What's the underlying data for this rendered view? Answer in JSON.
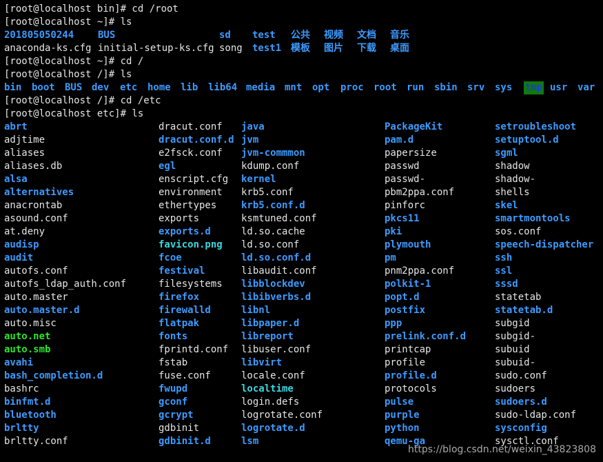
{
  "terminal": {
    "prompts": [
      "[root@localhost bin]# cd /root",
      "[root@localhost ~]# ls",
      "[root@localhost ~]# cd /",
      "[root@localhost /]# ls",
      "[root@localhost /]# cd /etc",
      "[root@localhost etc]# ls"
    ],
    "root_listing": [
      [
        {
          "text": "201805050244",
          "type": "dir"
        },
        {
          "text": "BUS",
          "type": "dir"
        },
        {
          "text": "sd",
          "type": "dir"
        },
        {
          "text": "test",
          "type": "dir"
        },
        {
          "text": "公共",
          "type": "dir"
        },
        {
          "text": "视频",
          "type": "dir"
        },
        {
          "text": "文档",
          "type": "dir"
        },
        {
          "text": "音乐",
          "type": "dir"
        }
      ],
      [
        {
          "text": "anaconda-ks.cfg",
          "type": "file"
        },
        {
          "text": "initial-setup-ks.cfg",
          "type": "file"
        },
        {
          "text": "song",
          "type": "file"
        },
        {
          "text": "test1",
          "type": "dir"
        },
        {
          "text": "模板",
          "type": "dir"
        },
        {
          "text": "图片",
          "type": "dir"
        },
        {
          "text": "下载",
          "type": "dir"
        },
        {
          "text": "桌面",
          "type": "dir"
        }
      ]
    ],
    "slash_listing": [
      {
        "text": "bin",
        "type": "dir"
      },
      {
        "text": "boot",
        "type": "dir"
      },
      {
        "text": "BUS",
        "type": "dir"
      },
      {
        "text": "dev",
        "type": "dir"
      },
      {
        "text": "etc",
        "type": "dir"
      },
      {
        "text": "home",
        "type": "dir"
      },
      {
        "text": "lib",
        "type": "dir"
      },
      {
        "text": "lib64",
        "type": "dir"
      },
      {
        "text": "media",
        "type": "dir"
      },
      {
        "text": "mnt",
        "type": "dir"
      },
      {
        "text": "opt",
        "type": "dir"
      },
      {
        "text": "proc",
        "type": "dir"
      },
      {
        "text": "root",
        "type": "dir"
      },
      {
        "text": "run",
        "type": "dir"
      },
      {
        "text": "sbin",
        "type": "dir"
      },
      {
        "text": "srv",
        "type": "dir"
      },
      {
        "text": "sys",
        "type": "dir"
      },
      {
        "text": "tmp",
        "type": "tmp"
      },
      {
        "text": "usr",
        "type": "dir"
      },
      {
        "text": "var",
        "type": "dir"
      }
    ],
    "etc_columns": [
      [
        {
          "text": "abrt",
          "type": "dir"
        },
        {
          "text": "adjtime",
          "type": "file"
        },
        {
          "text": "aliases",
          "type": "file"
        },
        {
          "text": "aliases.db",
          "type": "file"
        },
        {
          "text": "alsa",
          "type": "dir"
        },
        {
          "text": "alternatives",
          "type": "dir"
        },
        {
          "text": "anacrontab",
          "type": "file"
        },
        {
          "text": "asound.conf",
          "type": "file"
        },
        {
          "text": "at.deny",
          "type": "file"
        },
        {
          "text": "audisp",
          "type": "dir"
        },
        {
          "text": "audit",
          "type": "dir"
        },
        {
          "text": "autofs.conf",
          "type": "file"
        },
        {
          "text": "autofs_ldap_auth.conf",
          "type": "file"
        },
        {
          "text": "auto.master",
          "type": "file"
        },
        {
          "text": "auto.master.d",
          "type": "dir"
        },
        {
          "text": "auto.misc",
          "type": "file"
        },
        {
          "text": "auto.net",
          "type": "exec"
        },
        {
          "text": "auto.smb",
          "type": "exec"
        },
        {
          "text": "avahi",
          "type": "dir"
        },
        {
          "text": "bash_completion.d",
          "type": "dir"
        },
        {
          "text": "bashrc",
          "type": "file"
        },
        {
          "text": "binfmt.d",
          "type": "dir"
        },
        {
          "text": "bluetooth",
          "type": "dir"
        },
        {
          "text": "brltty",
          "type": "dir"
        },
        {
          "text": "brltty.conf",
          "type": "file"
        }
      ],
      [
        {
          "text": "dracut.conf",
          "type": "file"
        },
        {
          "text": "dracut.conf.d",
          "type": "dir"
        },
        {
          "text": "e2fsck.conf",
          "type": "file"
        },
        {
          "text": "egl",
          "type": "dir"
        },
        {
          "text": "enscript.cfg",
          "type": "file"
        },
        {
          "text": "environment",
          "type": "file"
        },
        {
          "text": "ethertypes",
          "type": "file"
        },
        {
          "text": "exports",
          "type": "file"
        },
        {
          "text": "exports.d",
          "type": "dir"
        },
        {
          "text": "favicon.png",
          "type": "link"
        },
        {
          "text": "fcoe",
          "type": "dir"
        },
        {
          "text": "festival",
          "type": "dir"
        },
        {
          "text": "filesystems",
          "type": "file"
        },
        {
          "text": "firefox",
          "type": "dir"
        },
        {
          "text": "firewalld",
          "type": "dir"
        },
        {
          "text": "flatpak",
          "type": "dir"
        },
        {
          "text": "fonts",
          "type": "dir"
        },
        {
          "text": "fprintd.conf",
          "type": "file"
        },
        {
          "text": "fstab",
          "type": "file"
        },
        {
          "text": "fuse.conf",
          "type": "file"
        },
        {
          "text": "fwupd",
          "type": "dir"
        },
        {
          "text": "gconf",
          "type": "dir"
        },
        {
          "text": "gcrypt",
          "type": "dir"
        },
        {
          "text": "gdbinit",
          "type": "file"
        },
        {
          "text": "gdbinit.d",
          "type": "dir"
        }
      ],
      [
        {
          "text": "java",
          "type": "dir"
        },
        {
          "text": "jvm",
          "type": "dir"
        },
        {
          "text": "jvm-commmon",
          "type": "dir"
        },
        {
          "text": "kdump.conf",
          "type": "file"
        },
        {
          "text": "kernel",
          "type": "dir"
        },
        {
          "text": "krb5.conf",
          "type": "file"
        },
        {
          "text": "krb5.conf.d",
          "type": "dir"
        },
        {
          "text": "ksmtuned.conf",
          "type": "file"
        },
        {
          "text": "ld.so.cache",
          "type": "file"
        },
        {
          "text": "ld.so.conf",
          "type": "file"
        },
        {
          "text": "ld.so.conf.d",
          "type": "dir"
        },
        {
          "text": "libaudit.conf",
          "type": "file"
        },
        {
          "text": "libblockdev",
          "type": "dir"
        },
        {
          "text": "libibverbs.d",
          "type": "dir"
        },
        {
          "text": "libnl",
          "type": "dir"
        },
        {
          "text": "libpaper.d",
          "type": "dir"
        },
        {
          "text": "libreport",
          "type": "dir"
        },
        {
          "text": "libuser.conf",
          "type": "file"
        },
        {
          "text": "libvirt",
          "type": "dir"
        },
        {
          "text": "locale.conf",
          "type": "file"
        },
        {
          "text": "localtime",
          "type": "link"
        },
        {
          "text": "login.defs",
          "type": "file"
        },
        {
          "text": "logrotate.conf",
          "type": "file"
        },
        {
          "text": "logrotate.d",
          "type": "dir"
        },
        {
          "text": "lsm",
          "type": "dir"
        }
      ],
      [
        {
          "text": "PackageKit",
          "type": "dir"
        },
        {
          "text": "pam.d",
          "type": "dir"
        },
        {
          "text": "papersize",
          "type": "file"
        },
        {
          "text": "passwd",
          "type": "file"
        },
        {
          "text": "passwd-",
          "type": "file"
        },
        {
          "text": "pbm2ppa.conf",
          "type": "file"
        },
        {
          "text": "pinforc",
          "type": "file"
        },
        {
          "text": "pkcs11",
          "type": "dir"
        },
        {
          "text": "pki",
          "type": "dir"
        },
        {
          "text": "plymouth",
          "type": "dir"
        },
        {
          "text": "pm",
          "type": "dir"
        },
        {
          "text": "pnm2ppa.conf",
          "type": "file"
        },
        {
          "text": "polkit-1",
          "type": "dir"
        },
        {
          "text": "popt.d",
          "type": "dir"
        },
        {
          "text": "postfix",
          "type": "dir"
        },
        {
          "text": "ppp",
          "type": "dir"
        },
        {
          "text": "prelink.conf.d",
          "type": "dir"
        },
        {
          "text": "printcap",
          "type": "file"
        },
        {
          "text": "profile",
          "type": "file"
        },
        {
          "text": "profile.d",
          "type": "dir"
        },
        {
          "text": "protocols",
          "type": "file"
        },
        {
          "text": "pulse",
          "type": "dir"
        },
        {
          "text": "purple",
          "type": "dir"
        },
        {
          "text": "python",
          "type": "dir"
        },
        {
          "text": "qemu-ga",
          "type": "dir"
        }
      ],
      [
        {
          "text": "setroubleshoot",
          "type": "dir"
        },
        {
          "text": "setuptool.d",
          "type": "dir"
        },
        {
          "text": "sgml",
          "type": "dir"
        },
        {
          "text": "shadow",
          "type": "file"
        },
        {
          "text": "shadow-",
          "type": "file"
        },
        {
          "text": "shells",
          "type": "file"
        },
        {
          "text": "skel",
          "type": "dir"
        },
        {
          "text": "smartmontools",
          "type": "dir"
        },
        {
          "text": "sos.conf",
          "type": "file"
        },
        {
          "text": "speech-dispatcher",
          "type": "dir"
        },
        {
          "text": "ssh",
          "type": "dir"
        },
        {
          "text": "ssl",
          "type": "dir"
        },
        {
          "text": "sssd",
          "type": "dir"
        },
        {
          "text": "statetab",
          "type": "file"
        },
        {
          "text": "statetab.d",
          "type": "dir"
        },
        {
          "text": "subgid",
          "type": "file"
        },
        {
          "text": "subgid-",
          "type": "file"
        },
        {
          "text": "subuid",
          "type": "file"
        },
        {
          "text": "subuid-",
          "type": "file"
        },
        {
          "text": "sudo.conf",
          "type": "file"
        },
        {
          "text": "sudoers",
          "type": "file"
        },
        {
          "text": "sudoers.d",
          "type": "dir"
        },
        {
          "text": "sudo-ldap.conf",
          "type": "file"
        },
        {
          "text": "sysconfig",
          "type": "dir"
        },
        {
          "text": "sysctl.conf",
          "type": "file"
        }
      ]
    ]
  },
  "watermark": "https://blog.csdn.net/weixin_43823808",
  "colors": {
    "background": "#000000",
    "directory": "#3d9bff",
    "symlink": "#3ad7e0",
    "executable": "#2ce62c",
    "plain_file": "#e6e6e6",
    "tmp_highlight": "#0f7a0f"
  }
}
